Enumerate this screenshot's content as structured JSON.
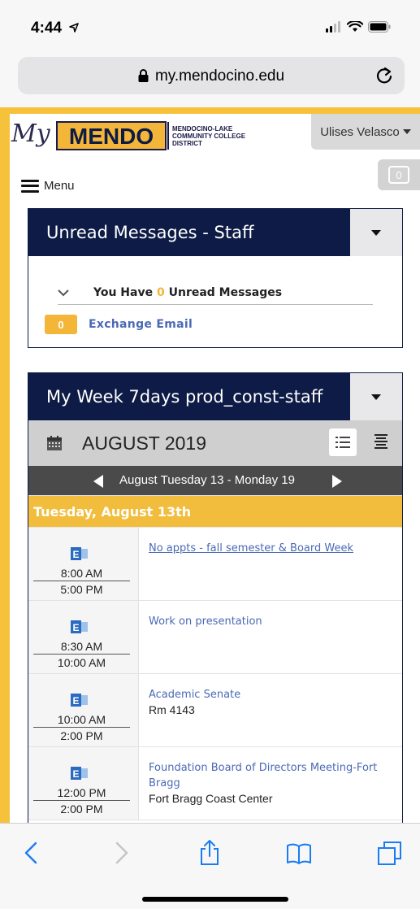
{
  "status_bar": {
    "time": "4:44"
  },
  "browser": {
    "url": "my.mendocino.edu"
  },
  "site": {
    "logo_my": "My",
    "logo_mendo": "MENDO",
    "logo_line1": "MENDOCINO-LAKE",
    "logo_line2": "COMMUNITY COLLEGE",
    "logo_line3": "DISTRICT",
    "user_name": "Ulises Velasco",
    "notification_count": "0",
    "menu_label": "Menu"
  },
  "messages_portlet": {
    "title": "Unread Messages - Staff",
    "unread_prefix": "You Have",
    "unread_count": "0",
    "unread_suffix": "Unread Messages",
    "email_count": "0",
    "email_label": "Exchange Email"
  },
  "week_portlet": {
    "title": "My Week 7days prod_const-staff",
    "month": "AUGUST 2019",
    "range": "August Tuesday 13 - Monday 19",
    "day": "Tuesday, August 13th",
    "events": [
      {
        "start": "8:00 AM",
        "end": "5:00 PM",
        "title": "No appts - fall semester & Board Week",
        "location": ""
      },
      {
        "start": "8:30 AM",
        "end": "10:00 AM",
        "title": "Work on presentation",
        "location": ""
      },
      {
        "start": "10:00 AM",
        "end": "2:00 PM",
        "title": "Academic Senate",
        "location": "Rm 4143"
      },
      {
        "start": "12:00 PM",
        "end": "2:00 PM",
        "title": "Foundation Board of Directors Meeting-Fort Bragg",
        "location": "Fort Bragg Coast Center"
      }
    ]
  },
  "colors": {
    "navy": "#0d1b46",
    "gold": "#f4b638",
    "link": "#4b6ab5",
    "ios_blue": "#1a7cf5"
  }
}
